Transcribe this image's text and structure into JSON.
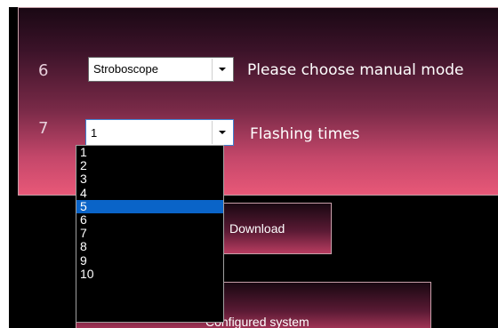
{
  "steps": [
    {
      "number": "6",
      "select_value": "Stroboscope",
      "label": "Please choose manual mode"
    },
    {
      "number": "7",
      "select_value": "1",
      "label": "Flashing times"
    }
  ],
  "dropdown": {
    "options": [
      "1",
      "2",
      "3",
      "4",
      "5",
      "6",
      "7",
      "8",
      "9",
      "10"
    ],
    "highlighted": "5"
  },
  "buttons": {
    "download": "Download",
    "configured_system": "Configured system"
  },
  "colors": {
    "highlight": "#0a64c8",
    "panel_top": "#1a0814",
    "panel_bottom": "#e85878"
  }
}
